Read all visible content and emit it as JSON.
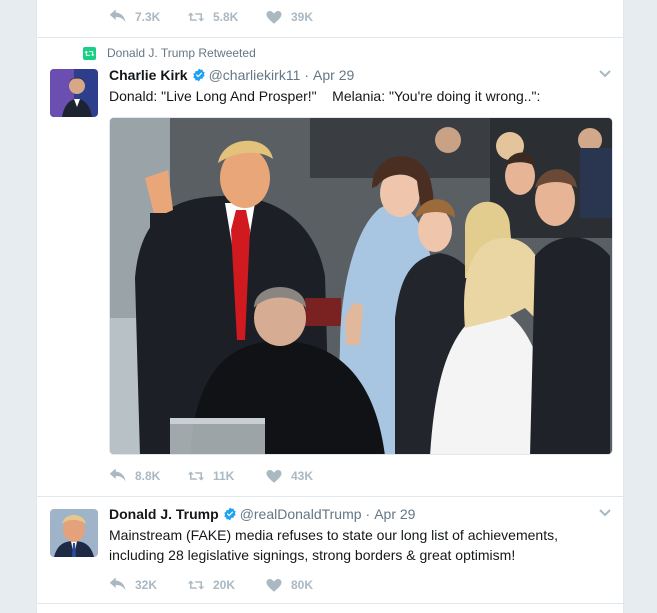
{
  "top_tweet": {
    "reply_count": "7.3K",
    "retweet_count": "5.8K",
    "like_count": "39K"
  },
  "retweeted_tweet": {
    "context_label": "Donald J. Trump Retweeted",
    "author_name": "Charlie Kirk",
    "author_handle": "@charliekirk11",
    "separator": "·",
    "timestamp": "Apr 29",
    "text": "Donald: \"Live Long And Prosper!\"    Melania: \"You're doing it wrong..\":",
    "reply_count": "8.8K",
    "retweet_count": "11K",
    "like_count": "43K"
  },
  "original_tweet": {
    "author_name": "Donald J. Trump",
    "author_handle": "@realDonaldTrump",
    "separator": "·",
    "timestamp": "Apr 29",
    "text": "Mainstream (FAKE) media refuses to state our long list of achievements, including 28 legislative signings, strong borders & great optimism!",
    "reply_count": "32K",
    "retweet_count": "20K",
    "like_count": "80K"
  },
  "icons": {
    "reply": "reply-icon",
    "retweet": "retweet-icon",
    "like": "heart-icon",
    "verified": "verified-badge-icon",
    "caret": "chevron-down-icon"
  },
  "colors": {
    "background": "#e6ecf0",
    "card": "#ffffff",
    "action_gray": "#aab8c2",
    "secondary_text": "#657786",
    "verified_blue": "#1da1f2",
    "retweet_green": "#19cf86"
  }
}
